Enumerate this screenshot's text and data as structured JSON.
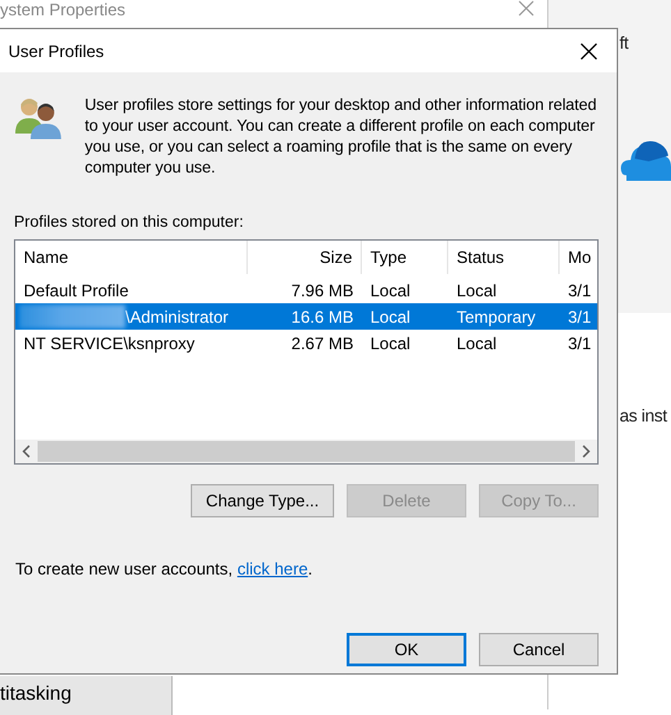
{
  "background": {
    "window_title": "ystem Properties",
    "side_texts": [
      "ft",
      "as inst"
    ],
    "panel_text": "titasking"
  },
  "dialog": {
    "title": "User Profiles",
    "description": "User profiles store settings for your desktop and other information related to your user account. You can create a different profile on each computer you use, or you can select a roaming profile that is the same on every computer you use.",
    "list_label": "Profiles stored on this computer:",
    "columns": [
      "Name",
      "Size",
      "Type",
      "Status",
      "Mo"
    ],
    "rows": [
      {
        "name": "Default Profile",
        "redacted": false,
        "size": "7.96 MB",
        "type": "Local",
        "status": "Local",
        "modified": "3/1",
        "selected": false
      },
      {
        "name": "\\Administrator",
        "redacted": true,
        "size": "16.6 MB",
        "type": "Local",
        "status": "Temporary",
        "modified": "3/1",
        "selected": true
      },
      {
        "name": "NT SERVICE\\ksnproxy",
        "redacted": false,
        "size": "2.67 MB",
        "type": "Local",
        "status": "Local",
        "modified": "3/1",
        "selected": false
      }
    ],
    "actions": [
      {
        "label": "Change Type...",
        "disabled": false
      },
      {
        "label": "Delete",
        "disabled": true
      },
      {
        "label": "Copy To...",
        "disabled": true
      }
    ],
    "footer_text": "To create new user accounts,",
    "link": "click here",
    "footer_end": ".",
    "buttons": [
      {
        "label": "OK",
        "default": true
      },
      {
        "label": "Cancel",
        "default": false
      }
    ]
  }
}
